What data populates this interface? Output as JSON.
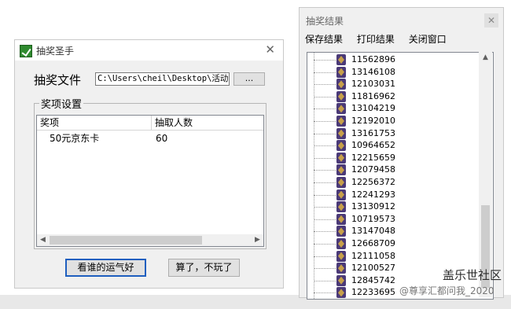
{
  "left_window": {
    "title": "抽奖圣手",
    "file_label": "抽奖文件",
    "file_path": "C:\\Users\\cheil\\Desktop\\活动\\抽",
    "browse_label": "...",
    "group_title": "奖项设置",
    "columns": [
      "奖项",
      "抽取人数"
    ],
    "rows": [
      {
        "prize": "50元京东卡",
        "count": "60"
      }
    ],
    "lucky_button": "看谁的运气好",
    "quit_button": "算了，不玩了"
  },
  "right_window": {
    "title": "抽奖结果",
    "menu": [
      "保存结果",
      "打印结果",
      "关闭窗口"
    ],
    "results": [
      "11562896",
      "13146108",
      "12103031",
      "11816962",
      "13104219",
      "12192010",
      "13161753",
      "10964652",
      "12215659",
      "12079458",
      "12256372",
      "12241293",
      "13130912",
      "10719573",
      "13147048",
      "12668709",
      "12111058",
      "12100527",
      "12845742",
      "12233695"
    ]
  },
  "watermark": {
    "site": "盖乐世社区",
    "user": "@尊享汇都问我_2020"
  },
  "icons": {
    "app": "app-icon",
    "close": "close-icon",
    "tree_item": "result-item-icon",
    "scroll_up": "scroll-up-icon",
    "scroll_left": "scroll-left-icon",
    "scroll_right": "scroll-right-icon"
  }
}
